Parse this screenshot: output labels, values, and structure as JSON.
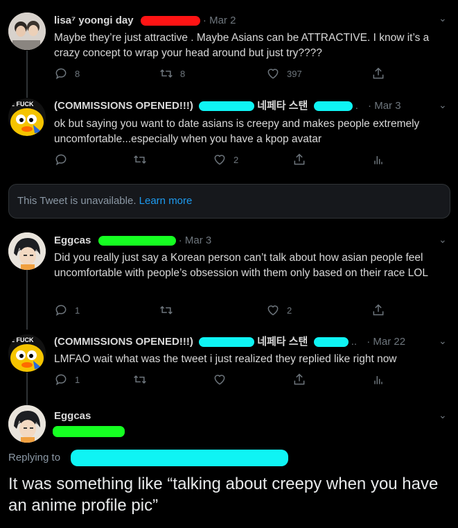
{
  "tweets": [
    {
      "name": "lisa⁷ yoongi day",
      "date": "Mar 2",
      "text": "Maybe they’re just attractive . Maybe Asians can be ATTRACTIVE. I know it’s a crazy concept to wrap your head around but just try????",
      "replies": "8",
      "retweets": "8",
      "likes": "397"
    },
    {
      "name": "(COMMISSIONS OPENED!!!)",
      "name_suffix": "네페타 스탠",
      "date": "Mar 3",
      "text": "ok but saying you want to date asians is creepy and makes people extremely uncomfortable...especially when you have a kpop avatar",
      "replies": "",
      "retweets": "",
      "likes": "2",
      "avatar_text": "E FUCK"
    },
    {
      "name": "Eggcas",
      "date": "Mar 3",
      "text": "Did you really just say a Korean person can’t talk about how asian people feel uncomfortable with people’s obsession with them only based on their race LOL",
      "replies": "1",
      "retweets": "",
      "likes": "2"
    },
    {
      "name": "(COMMISSIONS OPENED!!!)",
      "name_suffix": "네페타 스탠",
      "date": "Mar 22",
      "text": "LMFAO wait what was the tweet i just realized they replied like right now",
      "replies": "1",
      "retweets": "",
      "likes": "",
      "avatar_text": "E FUCK"
    }
  ],
  "unavailable": {
    "text": "This Tweet is unavailable.",
    "link": "Learn more"
  },
  "final_tweet": {
    "name": "Eggcas",
    "replying_label": "Replying to"
  },
  "caption": "It was something like “talking about creepy when you have an anime profile pic”",
  "colors": {
    "background": "#000000",
    "text": "#d9d9d9",
    "muted": "#6e767d",
    "link": "#1d9bf0",
    "redaction_red": "#ff1414",
    "redaction_cyan": "#0ff4f4",
    "redaction_green": "#16ff22"
  },
  "icons": [
    "reply-icon",
    "retweet-icon",
    "like-icon",
    "share-icon",
    "analytics-icon",
    "chevron-down-icon"
  ]
}
